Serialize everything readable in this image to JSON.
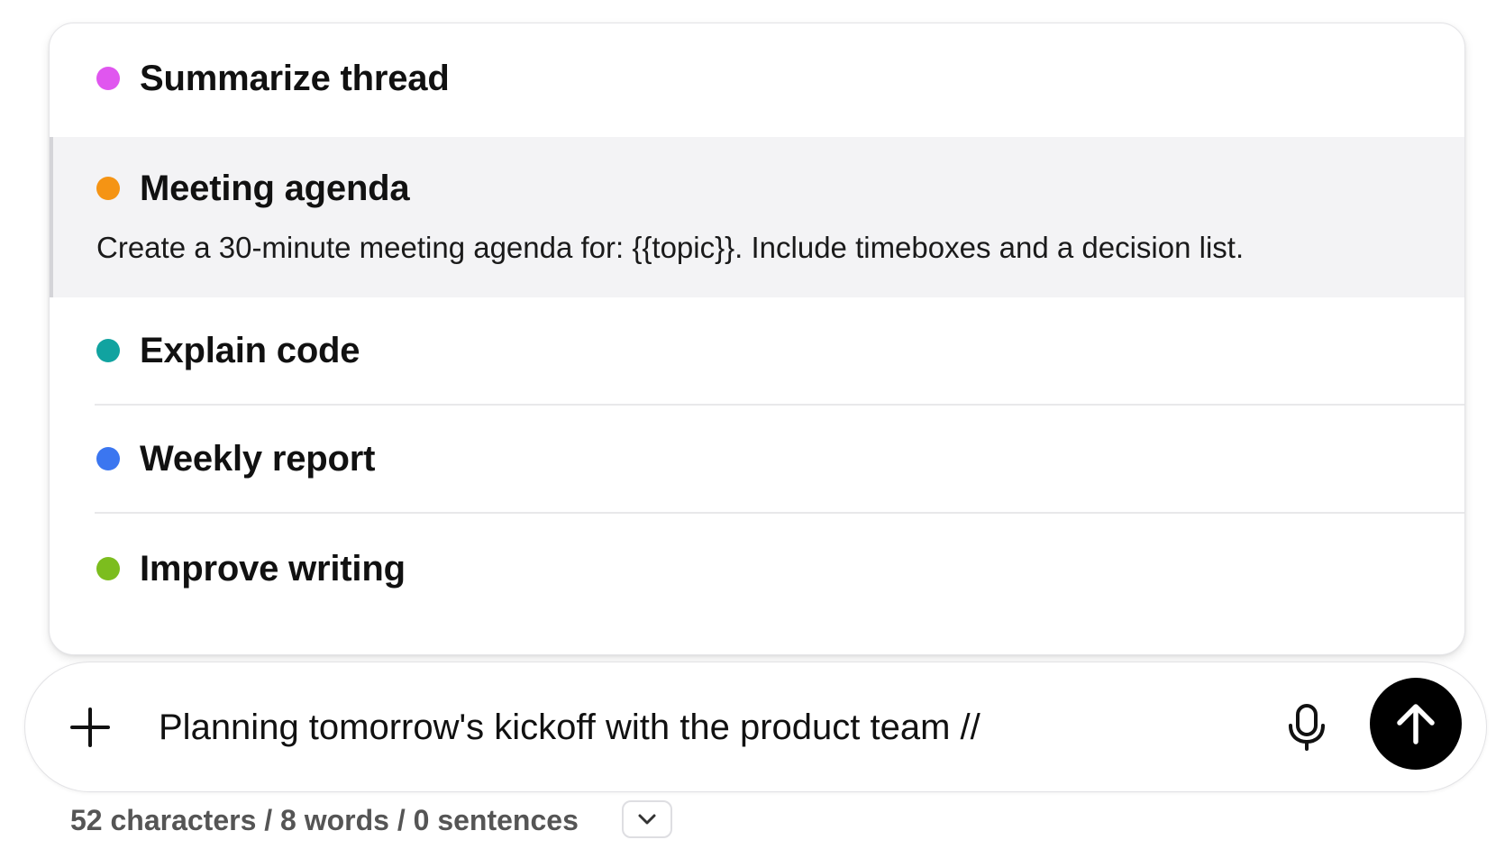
{
  "snippets": [
    {
      "title": "Summarize thread",
      "color": "#e056ef"
    },
    {
      "title": "Meeting agenda",
      "color": "#f59414",
      "description": "Create a 30-minute meeting agenda for: {{topic}}. Include timeboxes and a decision list."
    },
    {
      "title": "Explain code",
      "color": "#11a3a0"
    },
    {
      "title": "Weekly report",
      "color": "#3b76f0"
    },
    {
      "title": "Improve writing",
      "color": "#7cbd1e"
    }
  ],
  "composer": {
    "value": "Planning tomorrow's kickoff with the product team //",
    "add_icon": "plus-icon",
    "mic_icon": "microphone-icon",
    "send_icon": "arrow-up-icon"
  },
  "stats": {
    "text": "52 characters / 8 words / 0 sentences",
    "toggle_icon": "chevron-down-icon"
  }
}
